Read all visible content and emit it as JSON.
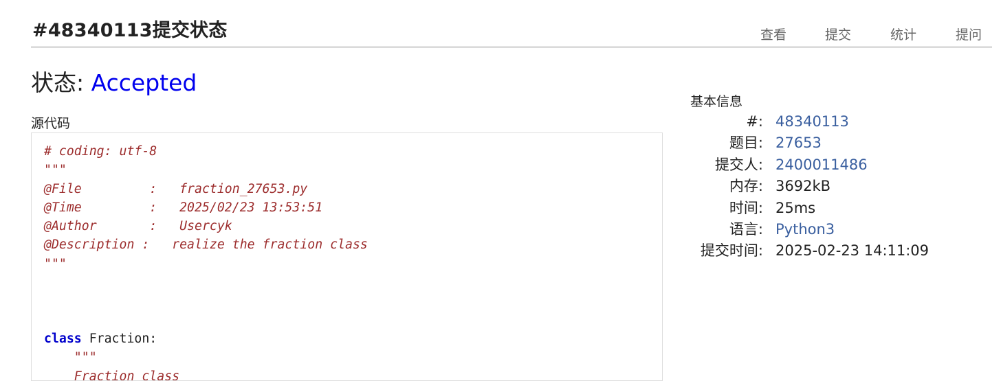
{
  "header": {
    "title": "#48340113提交状态",
    "nav": [
      {
        "label": "查看"
      },
      {
        "label": "提交"
      },
      {
        "label": "统计"
      },
      {
        "label": "提问"
      }
    ]
  },
  "status": {
    "label": "状态:",
    "value": "Accepted"
  },
  "source": {
    "label": "源代码",
    "lines": {
      "l1": "# coding: utf-8",
      "l2": "\"\"\"",
      "l3": "@File         :   fraction_27653.py",
      "l4": "@Time         :   2025/02/23 13:53:51",
      "l5": "@Author       :   Usercyk",
      "l6": "@Description :   realize the fraction class",
      "l7": "\"\"\"",
      "l11_kw": "class",
      "l11_rest": " Fraction:",
      "l12": "    \"\"\"",
      "l13": "    Fraction class"
    }
  },
  "info": {
    "title": "基本信息",
    "rows": [
      {
        "label": "#:",
        "value": "48340113",
        "link": true
      },
      {
        "label": "题目:",
        "value": "27653",
        "link": true
      },
      {
        "label": "提交人:",
        "value": "2400011486",
        "link": true
      },
      {
        "label": "内存:",
        "value": "3692kB",
        "link": false
      },
      {
        "label": "时间:",
        "value": "25ms",
        "link": false
      },
      {
        "label": "语言:",
        "value": "Python3",
        "link": true
      },
      {
        "label": "提交时间:",
        "value": "2025-02-23 14:11:09",
        "link": false
      }
    ]
  },
  "colors": {
    "accent": "#0000ee",
    "link": "#3a5f9f",
    "comment": "#9c2c2c",
    "keyword": "#0000cc"
  }
}
